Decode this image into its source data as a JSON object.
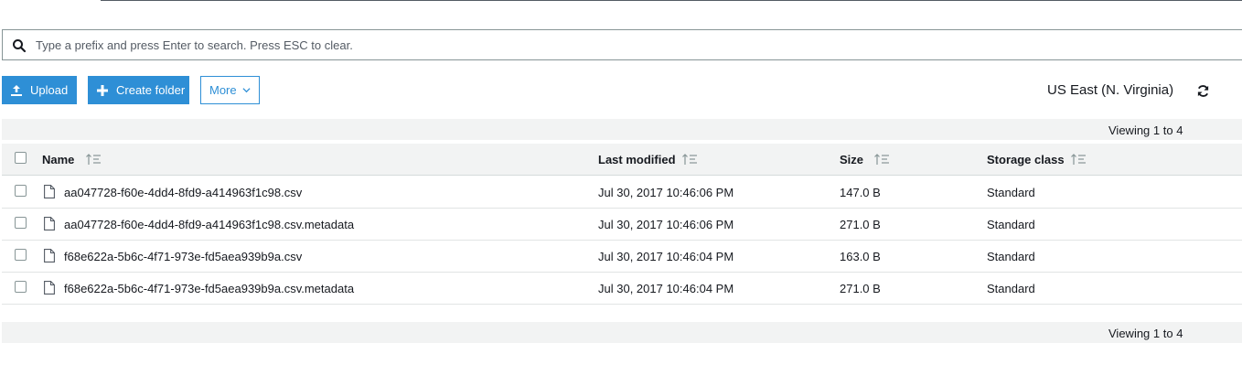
{
  "search": {
    "placeholder": "Type a prefix and press Enter to search. Press ESC to clear."
  },
  "toolbar": {
    "upload_label": "Upload",
    "create_folder_label": "Create folder",
    "more_label": "More",
    "region": "US East (N. Virginia)"
  },
  "viewing": {
    "top": "Viewing 1 to 4",
    "bottom": "Viewing 1 to 4"
  },
  "table": {
    "columns": [
      "Name",
      "Last modified",
      "Size",
      "Storage class"
    ],
    "rows": [
      {
        "name": "aa047728-f60e-4dd4-8fd9-a414963f1c98.csv",
        "modified": "Jul 30, 2017 10:46:06 PM",
        "size": "147.0 B",
        "storage_class": "Standard"
      },
      {
        "name": "aa047728-f60e-4dd4-8fd9-a414963f1c98.csv.metadata",
        "modified": "Jul 30, 2017 10:46:06 PM",
        "size": "271.0 B",
        "storage_class": "Standard"
      },
      {
        "name": "f68e622a-5b6c-4f71-973e-fd5aea939b9a.csv",
        "modified": "Jul 30, 2017 10:46:04 PM",
        "size": "163.0 B",
        "storage_class": "Standard"
      },
      {
        "name": "f68e622a-5b6c-4f71-973e-fd5aea939b9a.csv.metadata",
        "modified": "Jul 30, 2017 10:46:04 PM",
        "size": "271.0 B",
        "storage_class": "Standard"
      }
    ]
  },
  "colors": {
    "accent": "#2e8fd6",
    "bar_bg": "#f2f3f3",
    "border": "#879596"
  },
  "icons": [
    "search-icon",
    "upload-icon",
    "plus-icon",
    "chevron-down-icon",
    "refresh-icon",
    "sort-icon",
    "file-icon"
  ]
}
